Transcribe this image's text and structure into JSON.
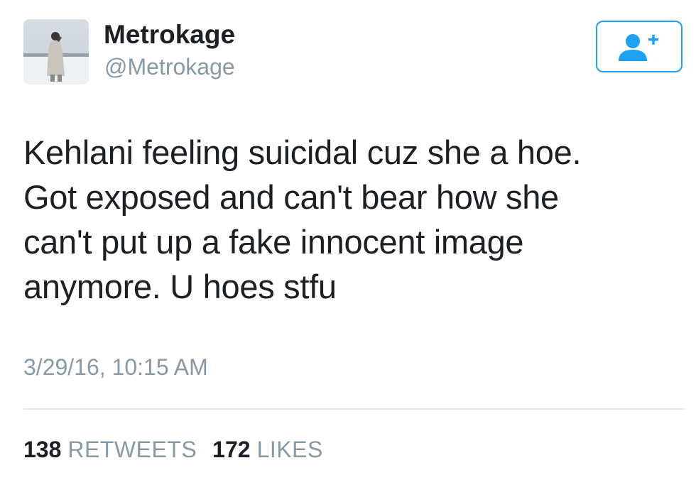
{
  "user": {
    "display_name": "Metrokage",
    "handle": "@Metrokage",
    "avatar_icon": "profile-photo"
  },
  "follow_button": {
    "icon": "add-user-icon",
    "color": "#1da1f2"
  },
  "tweet": {
    "lines": [
      "Kehlani feeling suicidal cuz she a hoe.",
      "Got exposed and can't bear how she",
      "can't put up a fake innocent image",
      "anymore. U hoes stfu"
    ],
    "timestamp": "3/29/16, 10:15 AM"
  },
  "stats": {
    "retweets_count": "138",
    "retweets_label": "RETWEETS",
    "likes_count": "172",
    "likes_label": "LIKES"
  },
  "colors": {
    "text": "#14171a",
    "muted": "#8899a6",
    "accent": "#1da1f2",
    "divider": "#e1e8ed"
  }
}
